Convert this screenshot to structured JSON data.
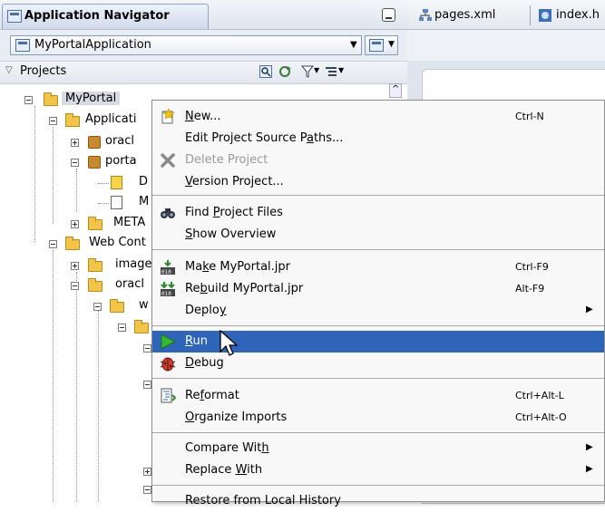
{
  "navigator": {
    "tab_title": "Application Navigator",
    "application": "MyPortalApplication",
    "projects_label": "Projects"
  },
  "editor": {
    "tabs": [
      {
        "label": "pages.xml"
      },
      {
        "label": "index.h"
      }
    ]
  },
  "tree": [
    {
      "label": "MyPortal"
    },
    {
      "label": "Applicati"
    },
    {
      "label": "oracl"
    },
    {
      "label": "porta"
    },
    {
      "label": "D"
    },
    {
      "label": "M"
    },
    {
      "label": "META"
    },
    {
      "label": "Web Cont"
    },
    {
      "label": "image"
    },
    {
      "label": "oracl"
    },
    {
      "label": "w"
    }
  ],
  "menu": {
    "items": [
      {
        "pre": "",
        "u": "N",
        "post": "ew...",
        "accel": "Ctrl-N"
      },
      {
        "pre": "Edit Project Source P",
        "u": "a",
        "post": "ths...",
        "accel": ""
      },
      {
        "pre": "Delete Project",
        "u": "",
        "post": "",
        "accel": ""
      },
      {
        "pre": "",
        "u": "V",
        "post": "ersion Project...",
        "accel": ""
      },
      {
        "pre": "Find ",
        "u": "P",
        "post": "roject Files",
        "accel": ""
      },
      {
        "pre": "",
        "u": "S",
        "post": "how Overview",
        "accel": ""
      },
      {
        "pre": "Ma",
        "u": "k",
        "post": "e MyPortal.jpr",
        "accel": "Ctrl-F9"
      },
      {
        "pre": "Re",
        "u": "b",
        "post": "uild MyPortal.jpr",
        "accel": "Alt-F9"
      },
      {
        "pre": "Deplo",
        "u": "y",
        "post": "",
        "accel": ""
      },
      {
        "pre": "",
        "u": "R",
        "post": "un",
        "accel": ""
      },
      {
        "pre": "",
        "u": "D",
        "post": "ebug",
        "accel": ""
      },
      {
        "pre": "Re",
        "u": "f",
        "post": "ormat",
        "accel": "Ctrl+Alt-L"
      },
      {
        "pre": "",
        "u": "O",
        "post": "rganize Imports",
        "accel": "Ctrl+Alt-O"
      },
      {
        "pre": "Compare Wit",
        "u": "h",
        "post": "",
        "accel": ""
      },
      {
        "pre": "Replace ",
        "u": "W",
        "post": "ith",
        "accel": ""
      },
      {
        "pre": "Restore from Local History",
        "u": "",
        "post": "",
        "accel": ""
      }
    ]
  },
  "colors": {
    "selection": "#2f65b8",
    "folder": "#f3c44a"
  }
}
